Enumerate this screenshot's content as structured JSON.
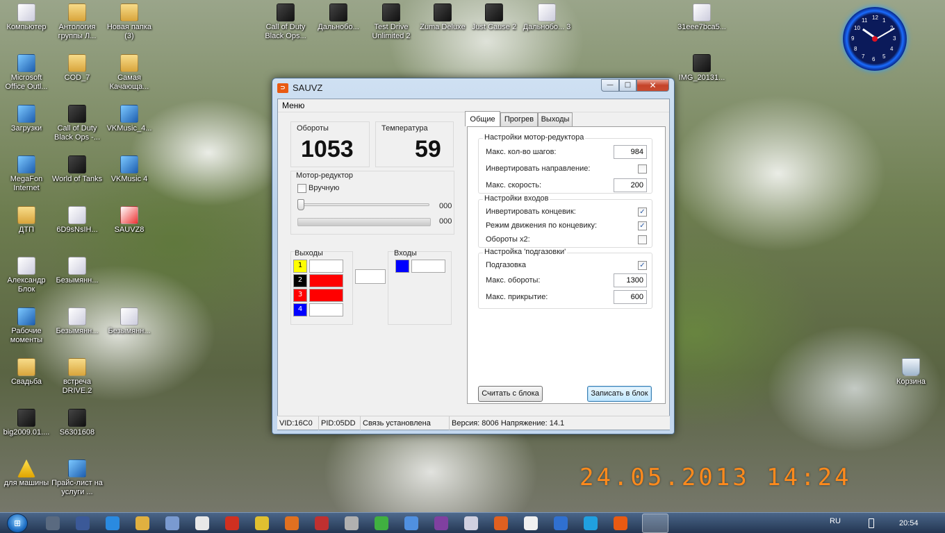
{
  "desktop": {
    "icons": [
      {
        "label": "Компьютер",
        "kind": "doc"
      },
      {
        "label": "Антология группы Л...",
        "kind": "folder"
      },
      {
        "label": "Новая папка (3)",
        "kind": "folder"
      },
      {
        "label": "Call of Duty Black Ops...",
        "kind": "game"
      },
      {
        "label": "Дальнобо...",
        "kind": "game"
      },
      {
        "label": "Test Drive Unlimited 2",
        "kind": "game"
      },
      {
        "label": "Zuma Deluxe",
        "kind": "game"
      },
      {
        "label": "Just Cause 2",
        "kind": "game"
      },
      {
        "label": "Дальнобо... 3",
        "kind": "doc"
      },
      {
        "label": "31eee7bca5...",
        "kind": "doc"
      },
      {
        "label": "Microsoft Office Outl...",
        "kind": "blue"
      },
      {
        "label": "COD_7",
        "kind": "folder"
      },
      {
        "label": "Самая Качающа...",
        "kind": "folder"
      },
      {
        "label": "IMG_20131...",
        "kind": "game"
      },
      {
        "label": "Загрузки",
        "kind": "blue"
      },
      {
        "label": "Call of Duty Black Ops -...",
        "kind": "game"
      },
      {
        "label": "VKMusic_4...",
        "kind": "blue"
      },
      {
        "label": "MegaFon Internet",
        "kind": "blue"
      },
      {
        "label": "World of Tanks",
        "kind": "game"
      },
      {
        "label": "VKMusic 4",
        "kind": "blue"
      },
      {
        "label": "ДТП",
        "kind": "folder"
      },
      {
        "label": "6D9sNsIH...",
        "kind": "doc"
      },
      {
        "label": "SAUVZ8",
        "kind": "pdf"
      },
      {
        "label": "Александр Блок",
        "kind": "doc"
      },
      {
        "label": "Безымянн...",
        "kind": "doc"
      },
      {
        "label": "Рабочие моменты",
        "kind": "blue"
      },
      {
        "label": "Безымянн...",
        "kind": "doc"
      },
      {
        "label": "Безымянн...",
        "kind": "doc"
      },
      {
        "label": "Свадьба",
        "kind": "folder"
      },
      {
        "label": "встреча DRIVE.2",
        "kind": "folder"
      },
      {
        "label": "Корзина",
        "kind": "bin"
      },
      {
        "label": "big2009.01....",
        "kind": "game"
      },
      {
        "label": "S6301608",
        "kind": "game"
      },
      {
        "label": "для машины",
        "kind": "warn"
      },
      {
        "label": "Прайс-лист на услуги ...",
        "kind": "blue"
      }
    ],
    "clock": {
      "hour": 10,
      "minute": 10,
      "numbers": [
        "12",
        "1",
        "2",
        "3",
        "4",
        "5",
        "6",
        "7",
        "8",
        "9",
        "10",
        "11"
      ]
    },
    "date_stamp": "24.05.2013 14:24"
  },
  "window": {
    "title": "SAUVZ",
    "icon_text": "⊃",
    "controls": {
      "minimize": "—",
      "maximize": "□",
      "close": "✕"
    },
    "menu": {
      "label": "Меню"
    },
    "rpm": {
      "label": "Обороты",
      "value": "1053"
    },
    "temperature": {
      "label": "Температура",
      "value": "59"
    },
    "motor": {
      "title": "Мотор-редуктор",
      "manual_label": "Вручную",
      "manual_checked": false,
      "slider_value": "000",
      "progress_value": "000"
    },
    "outputs": {
      "title": "Выходы",
      "rows": [
        {
          "num": "1",
          "color": "#ffff00",
          "text_color": "#000000",
          "state_color": "#ffffff"
        },
        {
          "num": "2",
          "color": "#000000",
          "text_color": "#ffffff",
          "state_color": "#ff0000"
        },
        {
          "num": "3",
          "color": "#ff0000",
          "text_color": "#ffffff",
          "state_color": "#ff0000"
        },
        {
          "num": "4",
          "color": "#0000ff",
          "text_color": "#ffffff",
          "state_color": "#ffffff"
        }
      ]
    },
    "inputs": {
      "title": "Входы",
      "color": "#0000ff"
    },
    "tabs": [
      {
        "label": "Общие",
        "active": true
      },
      {
        "label": "Прогрев",
        "active": false
      },
      {
        "label": "Выходы",
        "active": false
      }
    ],
    "motor_settings": {
      "title": "Настройки мотор-редуктора",
      "max_steps_label": "Макс. кол-во шагов:",
      "max_steps_value": "984",
      "invert_dir_label": "Инвертировать направление:",
      "invert_dir_checked": false,
      "max_speed_label": "Макс. скорость:",
      "max_speed_value": "200"
    },
    "input_settings": {
      "title": "Настройки  входов",
      "invert_limit_label": "Инвертировать концевик:",
      "invert_limit_checked": true,
      "limit_mode_label": "Режим движения по концевику:",
      "limit_mode_checked": true,
      "rpm_x2_label": "Обороты x2:",
      "rpm_x2_checked": false
    },
    "throttle_settings": {
      "title": "Настройка 'подгазовки'",
      "enable_label": "Подгазовка",
      "enable_checked": true,
      "max_rpm_label": "Макс. обороты:",
      "max_rpm_value": "1300",
      "max_close_label": "Макс. прикрытие:",
      "max_close_value": "600"
    },
    "buttons": {
      "read": "Считать с блока",
      "write": "Записать в блок"
    },
    "status": {
      "vid": "VID:16C0",
      "pid": "PID:05DD",
      "connection": "Связь установлена",
      "version": "Версия: 8006 Напряжение: 14.1"
    },
    "check_mark": "✓"
  },
  "taskbar": {
    "start_label": "⊞",
    "icons": [
      {
        "name": "vpn-icon",
        "color": "#5a6a80"
      },
      {
        "name": "facebook-icon",
        "color": "#3b5998"
      },
      {
        "name": "ie-icon",
        "color": "#2a8ae0"
      },
      {
        "name": "explorer-icon",
        "color": "#e0b040"
      },
      {
        "name": "tool-icon",
        "color": "#7a9ad0"
      },
      {
        "name": "yandex-icon",
        "color": "#e8e8e8"
      },
      {
        "name": "pdf-icon",
        "color": "#d03020"
      },
      {
        "name": "chrome-icon",
        "color": "#e0c030"
      },
      {
        "name": "app-icon",
        "color": "#e07020"
      },
      {
        "name": "opera-icon",
        "color": "#c03030"
      },
      {
        "name": "camera-icon",
        "color": "#b0b0b0"
      },
      {
        "name": "icq-icon",
        "color": "#40b040"
      },
      {
        "name": "finder-icon",
        "color": "#5090e0"
      },
      {
        "name": "rar-icon",
        "color": "#8040a0"
      },
      {
        "name": "magnifier-icon",
        "color": "#d0d0e0"
      },
      {
        "name": "media-icon",
        "color": "#e06020"
      },
      {
        "name": "panda-icon",
        "color": "#f0f0f0"
      },
      {
        "name": "lightning-icon",
        "color": "#3070d0"
      },
      {
        "name": "skype-icon",
        "color": "#20a0e0"
      },
      {
        "name": "sauvz-icon",
        "color": "#e95a12"
      }
    ],
    "lang": "RU",
    "time": "20:54"
  }
}
